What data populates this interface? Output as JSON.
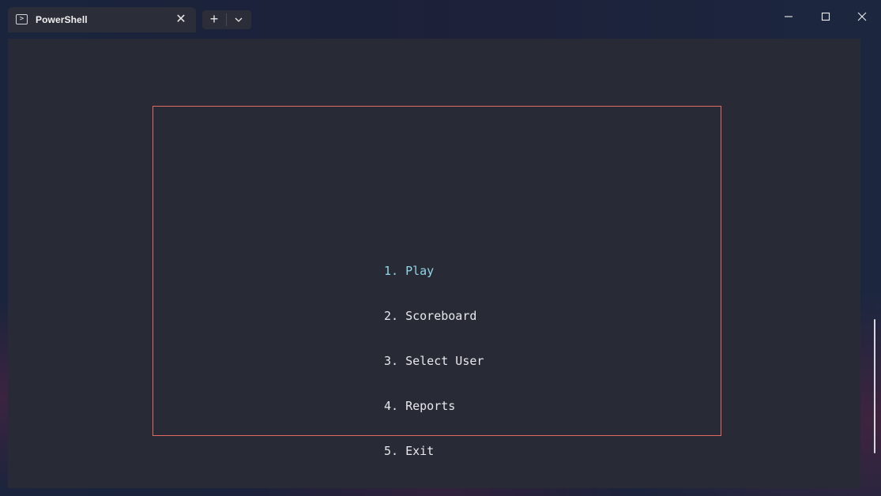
{
  "window": {
    "tab_title": "PowerShell",
    "tab_icon": "powershell-icon",
    "controls": [
      "minimize-icon",
      "maximize-icon",
      "close-icon"
    ]
  },
  "terminal": {
    "frame_color": "#e26a5e",
    "selected_color": "#8fd6e8",
    "text_color": "#e7e9ee",
    "menu": [
      {
        "label": "1. Play",
        "selected": true
      },
      {
        "label": "2. Scoreboard",
        "selected": false
      },
      {
        "label": "3. Select User",
        "selected": false
      },
      {
        "label": "4. Reports",
        "selected": false
      },
      {
        "label": "5. Exit",
        "selected": false
      }
    ]
  }
}
